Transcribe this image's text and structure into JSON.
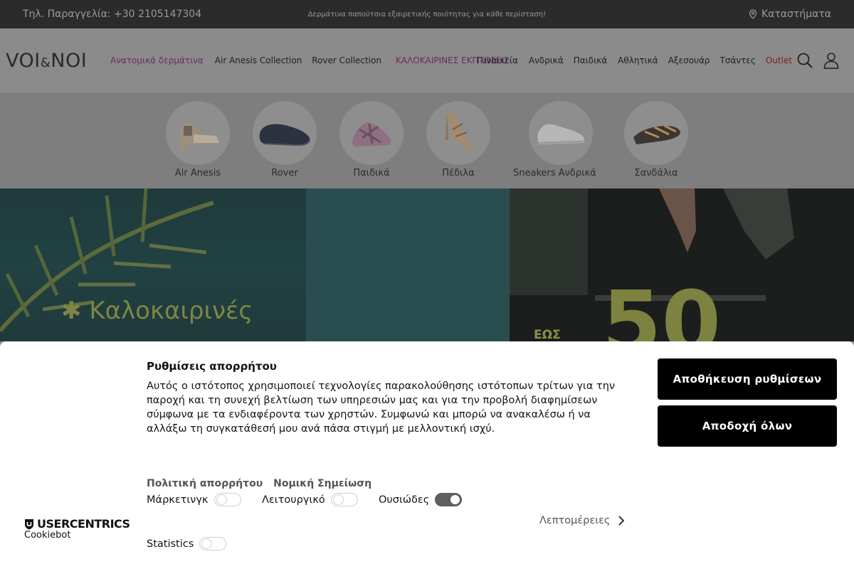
{
  "topbar": {
    "phone": "Τηλ. Παραγγελία: +30 2105147304",
    "promo": "Δερμάτινα παπούτσια εξαιρετικής ποιότητας για κάθε περίσταση!",
    "stores": "Καταστήματα"
  },
  "header": {
    "logo": {
      "left": "VOI",
      "amp": "&",
      "right": "NOI"
    },
    "nav": [
      {
        "label": "Ανατομικά δερμάτινα"
      },
      {
        "label": "Air Anesis Collection"
      },
      {
        "label": "Rover Collection"
      },
      {
        "label": "ΚΑΛΟΚΑΙΡΙΝΕΣ ΕΚΠΤΩΣΕΙΣ"
      },
      {
        "label": "Γυναικεία"
      },
      {
        "label": "Ανδρικά"
      },
      {
        "label": "Παιδικά"
      },
      {
        "label": "Αθλητικά"
      },
      {
        "label": "Αξεσουάρ"
      },
      {
        "label": "Τσάντες"
      },
      {
        "label": "Outlet"
      }
    ],
    "icons": [
      "search-icon",
      "user-icon"
    ]
  },
  "categories": [
    {
      "label": "Air Anesis",
      "icon": "heeled-sandal-icon"
    },
    {
      "label": "Rover",
      "icon": "loafer-icon"
    },
    {
      "label": "Παιδικά",
      "icon": "kids-sandal-icon"
    },
    {
      "label": "Πέδιλα",
      "icon": "high-heel-icon"
    },
    {
      "label": "Sneakers Ανδρικά",
      "icon": "sneaker-icon"
    },
    {
      "label": "Σανδάλια",
      "icon": "flat-sandal-icon"
    }
  ],
  "hero": {
    "left_text": "Καλοκαιρινές",
    "right_upto": "ΕΩΣ",
    "right_value": "50"
  },
  "cookie": {
    "title": "Ρυθμίσεις απορρήτου",
    "description": "Αυτός ο ιστότοπος χρησιμοποιεί τεχνολογίες παρακολούθησης ιστότοπων τρίτων για την παροχή και τη συνεχή βελτίωση των υπηρεσιών μας και για την προβολή διαφημίσεων σύμφωνα με τα ενδιαφέροντα των χρηστών. Συμφωνώ και μπορώ να ανακαλέσω ή να αλλάξω τη συγκατάθεσή μου ανά πάσα στιγμή με μελλοντική ισχύ.",
    "save_button": "Αποθήκευση ρυθμίσεων",
    "accept_button": "Αποδοχή όλων",
    "links": {
      "privacy": "Πολιτική απορρήτου",
      "legal": "Νομική Σημείωση"
    },
    "toggles": [
      {
        "label": "Μάρκετινγκ",
        "on": false
      },
      {
        "label": "Λειτουργικό",
        "on": false
      },
      {
        "label": "Ουσιώδες",
        "on": true
      },
      {
        "label": "Statistics",
        "on": false
      }
    ],
    "details": "Λεπτομέρειες",
    "brand": {
      "name": "USERCENTRICS",
      "sub": "Cookiebot"
    }
  },
  "colors": {
    "topbar_bg": "#2b2b2b",
    "accent_purple": "#a23a8e",
    "outlet_red": "#c0392b",
    "button_bg": "#000000"
  }
}
